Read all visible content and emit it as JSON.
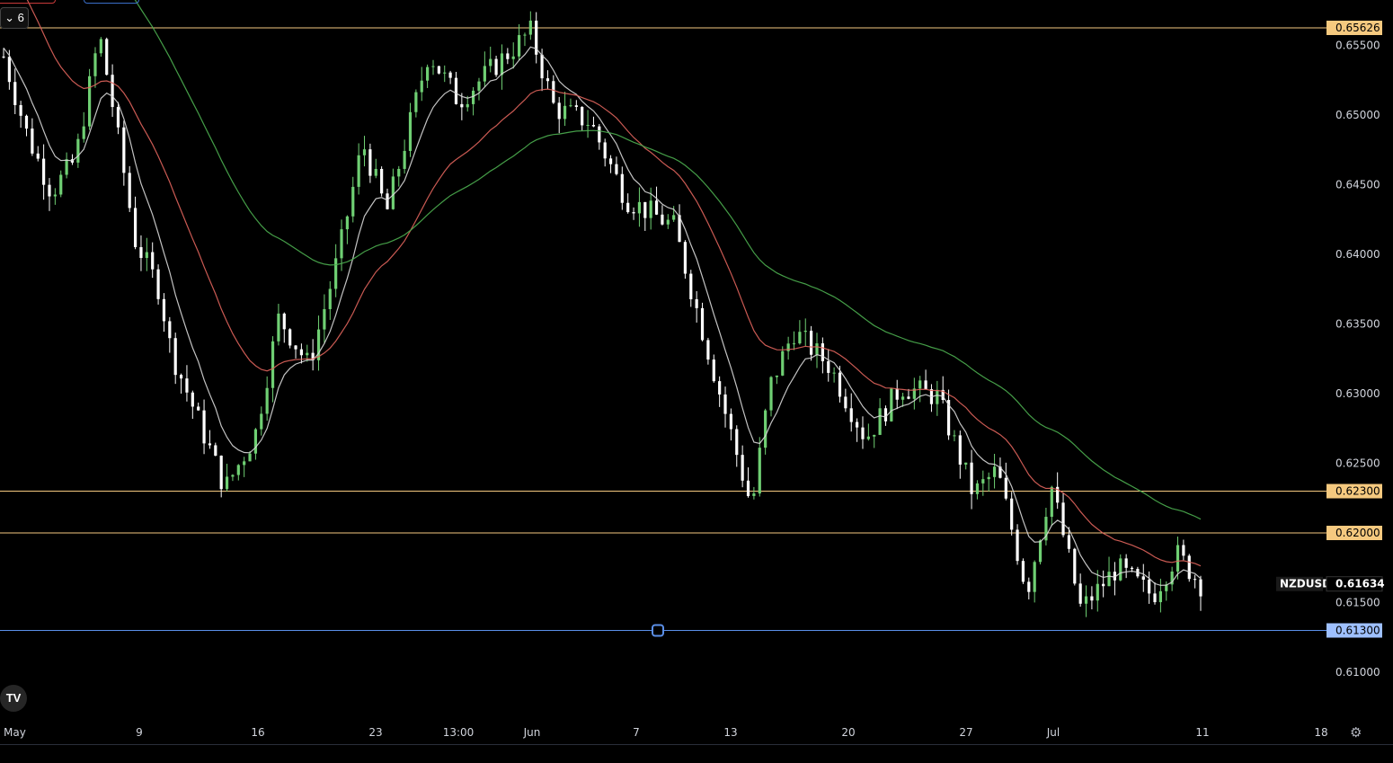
{
  "symbol": "NZDUSD",
  "interval_label": "6",
  "last_price": "0.61634",
  "colors": {
    "background": "#000000",
    "bull": "#6fcf73",
    "bear": "#ffffff",
    "ma_fast": "#d8d8d8",
    "ma_mid": "#e0645c",
    "ma_slow": "#4caf50",
    "level": "#f5c97f",
    "alert": "#5b8fe8"
  },
  "chart_data": {
    "type": "candlestick",
    "ylim": [
      0.606,
      0.6585
    ],
    "y_ticks": [
      "0.65500",
      "0.65000",
      "0.64500",
      "0.64000",
      "0.63500",
      "0.63000",
      "0.62500",
      "0.62000",
      "0.61500",
      "0.61000"
    ],
    "x_ticks": [
      "May",
      "9",
      "16",
      "23",
      "13:00",
      "Jun",
      "7",
      "13",
      "20",
      "27",
      "Jul",
      "11",
      "18"
    ],
    "horizontal_levels": [
      {
        "price": 0.65626,
        "label": "0.65626",
        "kind": "level"
      },
      {
        "price": 0.623,
        "label": "0.62300",
        "kind": "level"
      },
      {
        "price": 0.62,
        "label": "0.62000",
        "kind": "level"
      },
      {
        "price": 0.613,
        "label": "0.61300",
        "kind": "alert"
      }
    ],
    "price_path": [
      [
        0,
        0.6542
      ],
      [
        0.02,
        0.6485
      ],
      [
        0.04,
        0.6445
      ],
      [
        0.06,
        0.6468
      ],
      [
        0.08,
        0.6558
      ],
      [
        0.09,
        0.6512
      ],
      [
        0.11,
        0.641
      ],
      [
        0.13,
        0.6375
      ],
      [
        0.14,
        0.633
      ],
      [
        0.17,
        0.6265
      ],
      [
        0.185,
        0.6232
      ],
      [
        0.21,
        0.627
      ],
      [
        0.23,
        0.6355
      ],
      [
        0.255,
        0.632
      ],
      [
        0.28,
        0.64
      ],
      [
        0.3,
        0.648
      ],
      [
        0.32,
        0.643
      ],
      [
        0.355,
        0.6545
      ],
      [
        0.38,
        0.651
      ],
      [
        0.41,
        0.6535
      ],
      [
        0.44,
        0.656
      ],
      [
        0.46,
        0.6505
      ],
      [
        0.49,
        0.6495
      ],
      [
        0.52,
        0.644
      ],
      [
        0.56,
        0.642
      ],
      [
        0.6,
        0.6295
      ],
      [
        0.625,
        0.6218
      ],
      [
        0.64,
        0.6305
      ],
      [
        0.66,
        0.6345
      ],
      [
        0.69,
        0.632
      ],
      [
        0.72,
        0.6268
      ],
      [
        0.75,
        0.6305
      ],
      [
        0.78,
        0.6298
      ],
      [
        0.81,
        0.6228
      ],
      [
        0.83,
        0.6245
      ],
      [
        0.855,
        0.6158
      ],
      [
        0.875,
        0.6235
      ],
      [
        0.9,
        0.6145
      ],
      [
        0.93,
        0.6175
      ],
      [
        0.96,
        0.6155
      ],
      [
        0.98,
        0.6185
      ],
      [
        1,
        0.61634
      ]
    ],
    "n_candles": 210,
    "series": [
      {
        "kind": "ma_fast"
      },
      {
        "kind": "ma_mid"
      },
      {
        "kind": "ma_slow"
      }
    ]
  }
}
